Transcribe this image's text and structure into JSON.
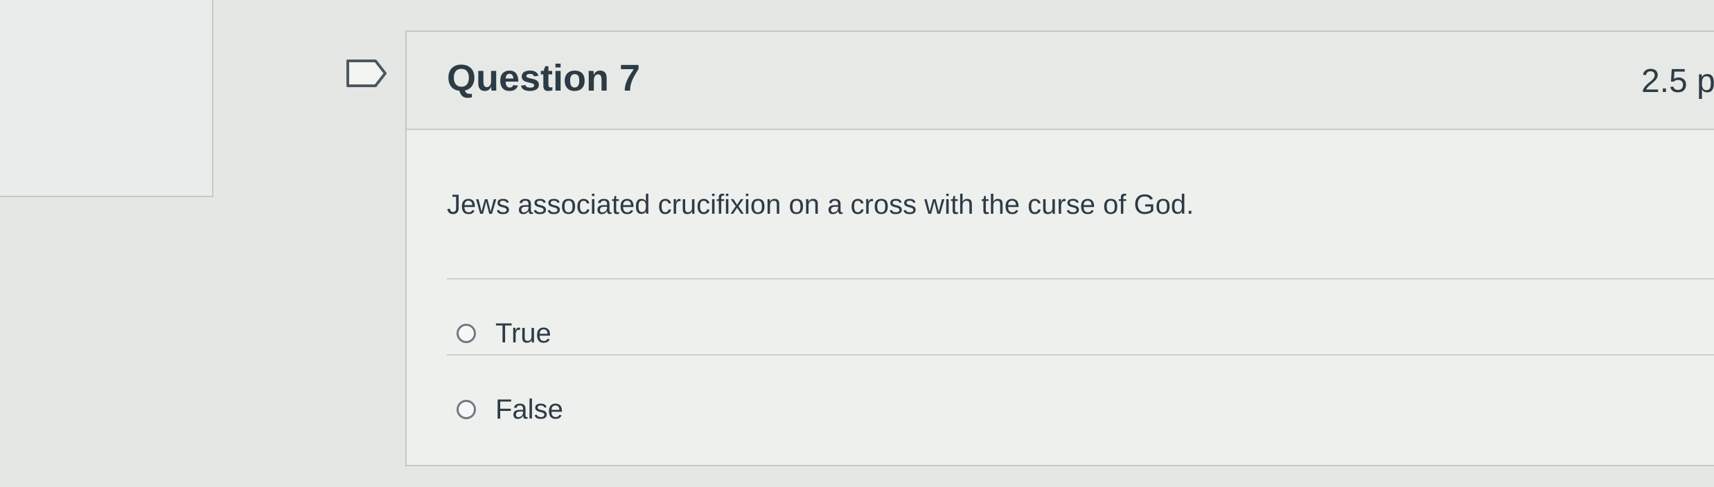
{
  "question": {
    "title": "Question 7",
    "points": "2.5 p",
    "text": "Jews associated crucifixion on a cross with the curse of God.",
    "answers": [
      {
        "label": "True"
      },
      {
        "label": "False"
      }
    ]
  },
  "icons": {
    "flag": "flag-question-icon",
    "radio": "radio-circle-icon"
  },
  "colors": {
    "text": "#2d3b45",
    "border": "#c5c9c6",
    "card_background": "#eef0ee",
    "page_background": "#e4e7e4"
  }
}
